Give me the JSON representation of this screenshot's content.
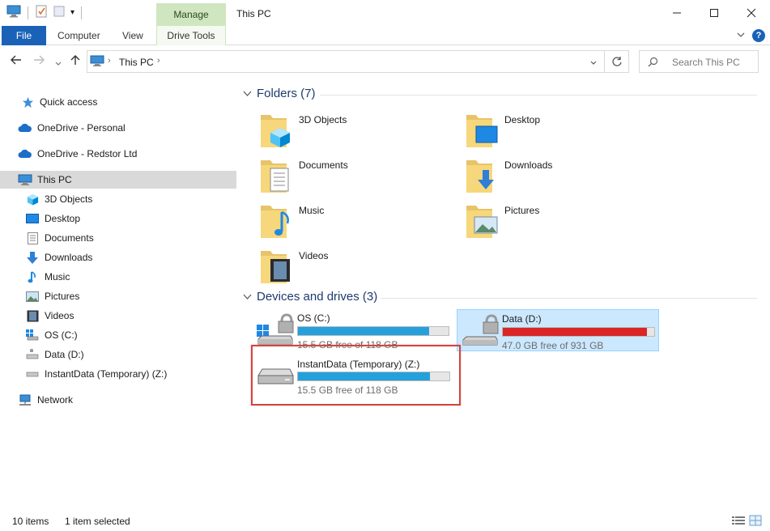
{
  "window": {
    "title": "This PC",
    "manage_tab": "Manage",
    "minimize": "—",
    "maximize": "☐",
    "close": "✕"
  },
  "ribbon": {
    "tabs": [
      "File",
      "Computer",
      "View",
      "Drive Tools"
    ],
    "help": "?"
  },
  "address": {
    "path": [
      "This PC"
    ],
    "search_placeholder": "Search This PC"
  },
  "sidebar": {
    "items": [
      {
        "label": "Quick access",
        "icon": "star-icon"
      },
      {
        "label": "OneDrive - Personal",
        "icon": "cloud-icon"
      },
      {
        "label": "OneDrive - Redstor Ltd",
        "icon": "cloud-icon"
      },
      {
        "label": "This PC",
        "icon": "monitor-icon"
      },
      {
        "label": "3D Objects",
        "icon": "cube-icon"
      },
      {
        "label": "Desktop",
        "icon": "desktop-icon"
      },
      {
        "label": "Documents",
        "icon": "document-icon"
      },
      {
        "label": "Downloads",
        "icon": "download-arrow-icon"
      },
      {
        "label": "Music",
        "icon": "music-note-icon"
      },
      {
        "label": "Pictures",
        "icon": "picture-icon"
      },
      {
        "label": "Videos",
        "icon": "film-icon"
      },
      {
        "label": "OS (C:)",
        "icon": "windows-drive-icon"
      },
      {
        "label": "Data (D:)",
        "icon": "drive-icon"
      },
      {
        "label": "InstantData (Temporary) (Z:)",
        "icon": "drive-icon"
      },
      {
        "label": "Network",
        "icon": "network-icon"
      }
    ]
  },
  "folders": {
    "header": "Folders (7)",
    "items": [
      {
        "name": "3D Objects",
        "icon": "cube-icon"
      },
      {
        "name": "Desktop",
        "icon": "desktop-icon"
      },
      {
        "name": "Documents",
        "icon": "document-icon"
      },
      {
        "name": "Downloads",
        "icon": "download-arrow-icon"
      },
      {
        "name": "Music",
        "icon": "music-note-icon"
      },
      {
        "name": "Pictures",
        "icon": "picture-icon"
      },
      {
        "name": "Videos",
        "icon": "film-icon"
      }
    ]
  },
  "drives": {
    "header": "Devices and drives (3)",
    "items": [
      {
        "name": "OS (C:)",
        "free": "15.5 GB free of 118 GB",
        "used_fraction": 0.87,
        "color": "#26a0da"
      },
      {
        "name": "Data (D:)",
        "free": "47.0 GB free of 931 GB",
        "used_fraction": 0.95,
        "color": "#da2626",
        "selected": true
      },
      {
        "name": "InstantData (Temporary) (Z:)",
        "free": "15.5 GB free of 118 GB",
        "used_fraction": 0.87,
        "color": "#26a0da",
        "highlighted": true
      }
    ]
  },
  "status": {
    "count": "10 items",
    "selection": "1 item selected"
  }
}
